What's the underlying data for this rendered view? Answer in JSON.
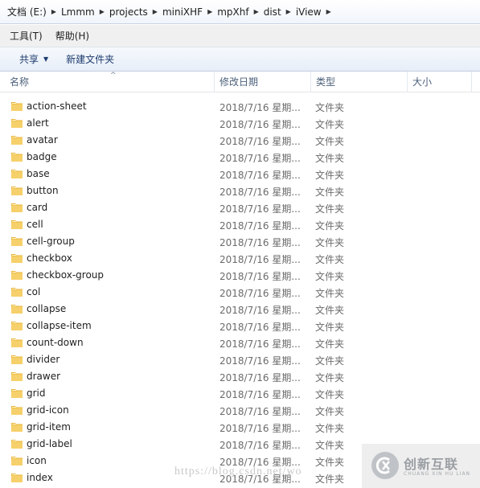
{
  "breadcrumb": [
    "文档 (E:)",
    "Lmmm",
    "projects",
    "miniXHF",
    "mpXhf",
    "dist",
    "iView"
  ],
  "menu": [
    "工具(T)",
    "帮助(H)"
  ],
  "toolbar": {
    "share_label": "共享",
    "new_folder_label": "新建文件夹"
  },
  "columns": {
    "name": "名称",
    "date": "修改日期",
    "type": "类型",
    "size": "大小"
  },
  "rows": [
    {
      "name": "action-sheet",
      "date": "2018/7/16 星期...",
      "type": "文件夹"
    },
    {
      "name": "alert",
      "date": "2018/7/16 星期...",
      "type": "文件夹"
    },
    {
      "name": "avatar",
      "date": "2018/7/16 星期...",
      "type": "文件夹"
    },
    {
      "name": "badge",
      "date": "2018/7/16 星期...",
      "type": "文件夹"
    },
    {
      "name": "base",
      "date": "2018/7/16 星期...",
      "type": "文件夹"
    },
    {
      "name": "button",
      "date": "2018/7/16 星期...",
      "type": "文件夹"
    },
    {
      "name": "card",
      "date": "2018/7/16 星期...",
      "type": "文件夹"
    },
    {
      "name": "cell",
      "date": "2018/7/16 星期...",
      "type": "文件夹"
    },
    {
      "name": "cell-group",
      "date": "2018/7/16 星期...",
      "type": "文件夹"
    },
    {
      "name": "checkbox",
      "date": "2018/7/16 星期...",
      "type": "文件夹"
    },
    {
      "name": "checkbox-group",
      "date": "2018/7/16 星期...",
      "type": "文件夹"
    },
    {
      "name": "col",
      "date": "2018/7/16 星期...",
      "type": "文件夹"
    },
    {
      "name": "collapse",
      "date": "2018/7/16 星期...",
      "type": "文件夹"
    },
    {
      "name": "collapse-item",
      "date": "2018/7/16 星期...",
      "type": "文件夹"
    },
    {
      "name": "count-down",
      "date": "2018/7/16 星期...",
      "type": "文件夹"
    },
    {
      "name": "divider",
      "date": "2018/7/16 星期...",
      "type": "文件夹"
    },
    {
      "name": "drawer",
      "date": "2018/7/16 星期...",
      "type": "文件夹"
    },
    {
      "name": "grid",
      "date": "2018/7/16 星期...",
      "type": "文件夹"
    },
    {
      "name": "grid-icon",
      "date": "2018/7/16 星期...",
      "type": "文件夹"
    },
    {
      "name": "grid-item",
      "date": "2018/7/16 星期...",
      "type": "文件夹"
    },
    {
      "name": "grid-label",
      "date": "2018/7/16 星期...",
      "type": "文件夹"
    },
    {
      "name": "icon",
      "date": "2018/7/16 星期...",
      "type": "文件夹"
    },
    {
      "name": "index",
      "date": "2018/7/16 星期...",
      "type": "文件夹"
    }
  ],
  "watermark": {
    "url": "https://blog.csdn.net/wo",
    "brand": "创新互联",
    "brand_sub": "CHUANG XIN HU LIAN"
  },
  "icons": {
    "folder": "folder-icon",
    "separator": "chevron-right-icon",
    "dropdown": "caret-down-icon",
    "sort": "sort-up-icon"
  }
}
